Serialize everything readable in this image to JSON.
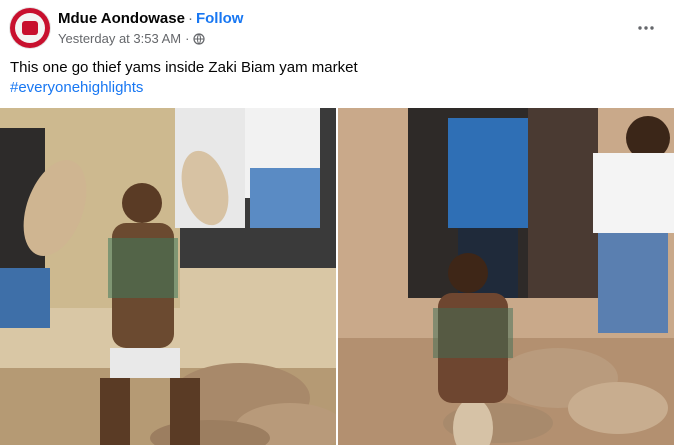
{
  "post": {
    "author": "Mdue Aondowase",
    "separator": "·",
    "follow_label": "Follow",
    "timestamp": "Yesterday at 3:53 AM",
    "meta_separator": "·",
    "audience_icon": "globe-icon",
    "more_icon": "more-options-icon",
    "caption": "This one go thief yams inside Zaki Biam yam market",
    "hashtag": "#everyonehighlights",
    "photos": [
      {
        "name": "photo-left"
      },
      {
        "name": "photo-right"
      }
    ]
  },
  "colors": {
    "link": "#1877f2",
    "secondary_text": "#65676b",
    "primary_text": "#050505",
    "background": "#ffffff"
  }
}
